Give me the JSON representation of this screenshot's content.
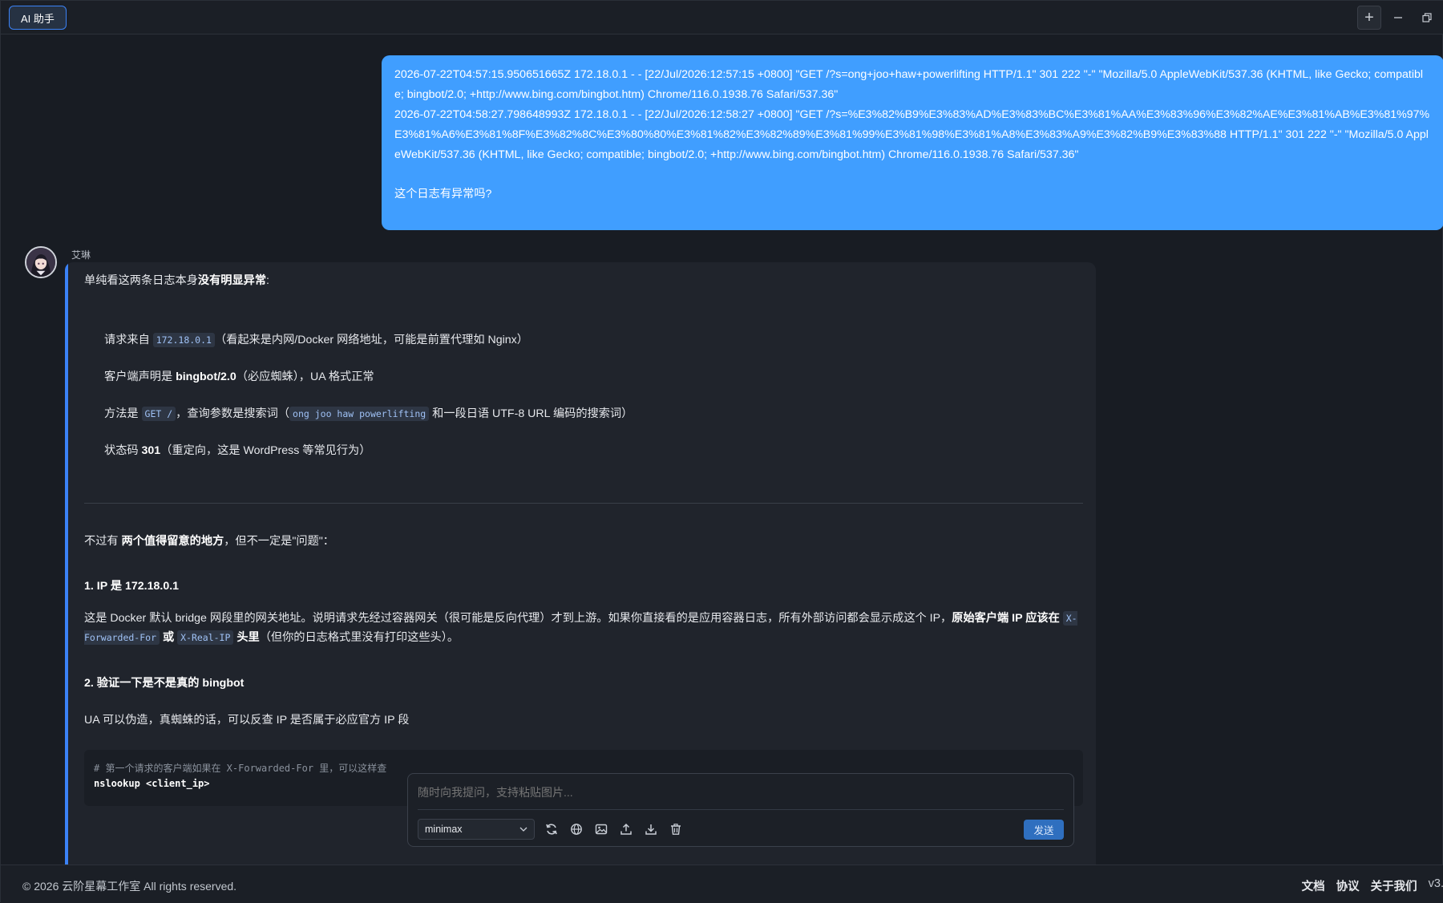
{
  "titlebar": {
    "app_tab": "AI 助手",
    "add_icon": "+"
  },
  "user_message": {
    "log_lines": [
      "2026-07-22T04:57:15.950651665Z 172.18.0.1 - - [22/Jul/2026:12:57:15 +0800] \"GET /?s=ong+joo+haw+powerlifting HTTP/1.1\" 301 222 \"-\" \"Mozilla/5.0 AppleWebKit/537.36 (KHTML, like Gecko; compatible; bingbot/2.0; +http://www.bing.com/bingbot.htm) Chrome/116.0.1938.76 Safari/537.36\"",
      "2026-07-22T04:58:27.798648993Z 172.18.0.1 - - [22/Jul/2026:12:58:27 +0800] \"GET /?s=%E3%82%B9%E3%83%AD%E3%83%BC%E3%81%AA%E3%83%96%E3%82%AE%E3%81%AB%E3%81%97%E3%81%A6%E3%81%8F%E3%82%8C%E3%80%80%E3%81%82%E3%82%89%E3%81%99%E3%81%98%E3%81%A8%E3%83%A9%E3%82%B9%E3%83%88 HTTP/1.1\" 301 222 \"-\" \"Mozilla/5.0 AppleWebKit/537.36 (KHTML, like Gecko; compatible; bingbot/2.0; +http://www.bing.com/bingbot.htm) Chrome/116.0.1938.76 Safari/537.36\""
    ],
    "question": "这个日志有异常吗?"
  },
  "bot": {
    "name": "艾琳",
    "intro_prefix": "单纯看这两条日志本身",
    "intro_bold": "没有明显异常",
    "intro_suffix": ":",
    "bullets": [
      {
        "a": "请求来自 ",
        "code": "172.18.0.1",
        "b": "（看起来是内网/Docker 网络地址，可能是前置代理如 Nginx）"
      },
      {
        "a": "客户端声明是 ",
        "bold": "bingbot/2.0",
        "b": "（必应蜘蛛），UA 格式正常"
      },
      {
        "a": "方法是 ",
        "code": "GET /",
        "b": "，查询参数是搜索词（",
        "code2": "ong joo haw powerlifting",
        "c": " 和一段日语 UTF-8 URL 编码的搜索词）"
      },
      {
        "a": "状态码 ",
        "bold": "301",
        "b": "（重定向，这是 WordPress 等常见行为）"
      }
    ],
    "notice_prefix": "不过有 ",
    "notice_bold": "两个值得留意的地方",
    "notice_suffix": "，但不一定是\"问题\"：",
    "point1_title": "1. IP 是 172.18.0.1",
    "point1_text": "这是 Docker 默认 bridge 网段里的网关地址。说明请求先经过容器网关（很可能是反向代理）才到上游。如果你直接看的是应用容器日志，所有外部访问都会显示成这个 IP，",
    "point1_bold": "原始客户端 IP 应该在 ",
    "point1_code1": "X-Forwarded-For",
    "point1_or": " 或 ",
    "point1_code2": "X-Real-IP",
    "point1_bold2": " 头里",
    "point1_tail": "（但你的日志格式里没有打印这些头）。",
    "point2_title": "2. 验证一下是不是真的 bingbot",
    "point2_text": "UA 可以伪造，真蜘蛛的话，可以反查 IP 是否属于必应官方 IP 段",
    "code_comment": "# 第一个请求的客户端如果在 X-Forwarded-For 里，可以这样查",
    "code_cmd": "nslookup <client_ip>"
  },
  "composer": {
    "placeholder": "随时向我提问，支持粘贴图片...",
    "model": "minimax",
    "send_label": "发送",
    "tools": [
      "refresh-icon",
      "globe-icon",
      "image-icon",
      "upload-icon",
      "download-icon",
      "trash-icon"
    ]
  },
  "footer": {
    "copyright": "© 2026 云阶星幕工作室 All rights reserved.",
    "links": [
      "文档",
      "协议",
      "关于我们"
    ],
    "version": "v3."
  },
  "colors": {
    "accent": "#409eff",
    "background": "#181c23",
    "card": "#20242c",
    "send": "#2f6fbf"
  }
}
